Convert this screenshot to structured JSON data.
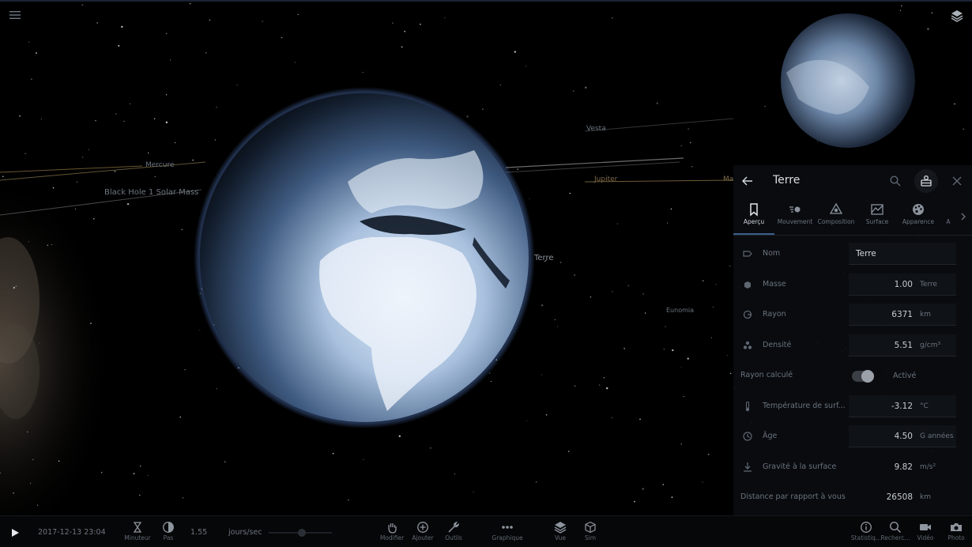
{
  "space_labels": {
    "mercure": "Mercure",
    "black_hole": "Black Hole 1 Solar Mass",
    "vesta": "Vesta",
    "jupiter": "Jupiter",
    "terre": "Terre",
    "eunomia": "Eunomia",
    "ma": "Ma"
  },
  "panel": {
    "title": "Terre",
    "tabs": [
      {
        "label": "Aperçu",
        "icon": "bookmark-icon"
      },
      {
        "label": "Mouvement",
        "icon": "motion-icon"
      },
      {
        "label": "Composition",
        "icon": "composition-icon"
      },
      {
        "label": "Surface",
        "icon": "surface-icon"
      },
      {
        "label": "Apparence",
        "icon": "palette-icon"
      },
      {
        "label": "A",
        "icon": "more-icon"
      }
    ],
    "props": {
      "nom": {
        "label": "Nom",
        "value": "Terre"
      },
      "masse": {
        "label": "Masse",
        "value": "1.00",
        "unit": "Terre"
      },
      "rayon": {
        "label": "Rayon",
        "value": "6371",
        "unit": "km"
      },
      "densite": {
        "label": "Densité",
        "value": "5.51",
        "unit": "g/cm³"
      },
      "rayon_calcule": {
        "label": "Rayon calculé",
        "state": "Activé"
      },
      "temperature": {
        "label": "Température de surf...",
        "value": "-3.12",
        "unit": "°C"
      },
      "age": {
        "label": "Âge",
        "value": "4.50",
        "unit": "G années"
      },
      "gravite": {
        "label": "Gravité à la surface",
        "value": "9.82",
        "unit": "m/s²"
      },
      "distance": {
        "label": "Distance par rapport à vous",
        "value": "26508",
        "unit": "km"
      }
    }
  },
  "toolbar": {
    "date": "2017-12-13 23:04",
    "minuteur": "Minuteur",
    "pas": "Pas",
    "speed_value": "1.55",
    "speed_unit": "jours/sec",
    "modifier": "Modifier",
    "ajouter": "Ajouter",
    "outils": "Outils",
    "graphique": "Graphique",
    "vue": "Vue",
    "sim": "Sim",
    "statistiques": "Statistiq...",
    "rechercher": "Recherc...",
    "video": "Vidéo",
    "photo": "Photo"
  },
  "colors": {
    "planet_light": "#dfeaf7",
    "planet_mid": "#7f9ec4",
    "planet_dark": "#0d1726",
    "panel_bg": "#0a0c10",
    "accent": "#3d5f8a"
  }
}
